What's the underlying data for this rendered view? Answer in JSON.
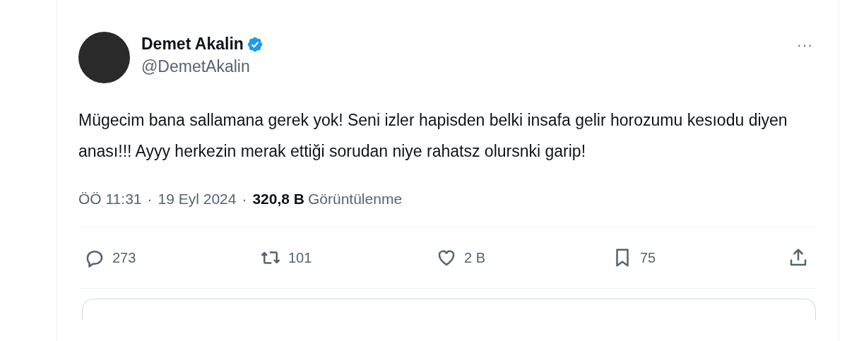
{
  "author": {
    "name": "Demet Akalin",
    "verified": true,
    "handle": "@DemetAkalin"
  },
  "more_button": "···",
  "text": "Mügecim bana sallamana gerek yok! Seni izler hapisden belki insafa gelir horozumu kesıodu diyen anası!!! Ayyy herkezin merak ettiği sorudan niye rahatsz olursnki garip!",
  "meta": {
    "time": "ÖÖ 11:31",
    "separator_1": "·",
    "date": "19 Eyl 2024",
    "separator_2": "·",
    "views_count": "320,8 B",
    "views_label": "Görüntülenme"
  },
  "actions": [
    {
      "kind": "reply",
      "count": "273"
    },
    {
      "kind": "repost",
      "count": "101"
    },
    {
      "kind": "like",
      "count": "2 B"
    },
    {
      "kind": "bookmark",
      "count": "75"
    },
    {
      "kind": "share"
    }
  ]
}
